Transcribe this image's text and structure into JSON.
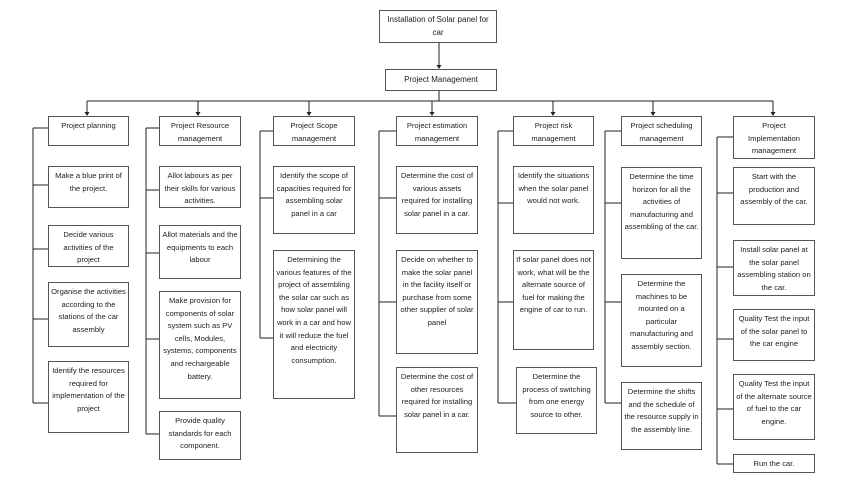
{
  "title": "Installation of Solar panel for car",
  "root": "Project Management",
  "columns": [
    {
      "header": "Project planning",
      "items": [
        "Make a blue print of the project.",
        "Decide various activities of the project",
        "Organise the activities according to the stations of the car assembly",
        "Identify the resources required for implementation of the project"
      ]
    },
    {
      "header": "Project Resource management",
      "items": [
        "Allot labours as per their skills for various activities.",
        "Allot materials and the equipments to each labour",
        "Make provision for components of solar system such as PV cells, Modules, systems, components and rechargeable battery.",
        "Provide quality standards for each component."
      ]
    },
    {
      "header": "Project Scope management",
      "items": [
        "Identify the scope of capacities required for assembling solar panel in a car",
        "Determining the various features of the project of assembling the solar car such as how solar panel will work in a car and how it will reduce the fuel and electricity consumption."
      ]
    },
    {
      "header": "Project estimation management",
      "items": [
        "Determine the cost of various assets required for installing solar panel in a car.",
        "Decide on whether to make the solar panel in the facility itself or purchase from some other supplier of solar panel",
        "Determine the cost of other resources required for installing solar panel in a car."
      ]
    },
    {
      "header": "Project risk management",
      "items": [
        "Identify the situations when the solar panel would not work.",
        "If solar panel does not work, what will be the alternate source of fuel for making the engine of car to run.",
        "Determine the process of switching from one energy source to other."
      ]
    },
    {
      "header": "Project scheduling management",
      "items": [
        "Determine the time horizon for all the activities of manufacturing and assembling of the car.",
        "Determine the machines to be mounted on a particular manufacturing and assembly section.",
        "Determine the shifts and the schedule of the resource supply in the assembly line."
      ]
    },
    {
      "header": "Project Implementation management",
      "items": [
        "Start with the production and assembly of the car.",
        "Install solar panel at the solar panel assembling station on the car.",
        "Quality Test the input of the solar panel to the car engine",
        "Quality Test the input of the alternate source of fuel to the car engine.",
        "Run the car."
      ]
    }
  ]
}
